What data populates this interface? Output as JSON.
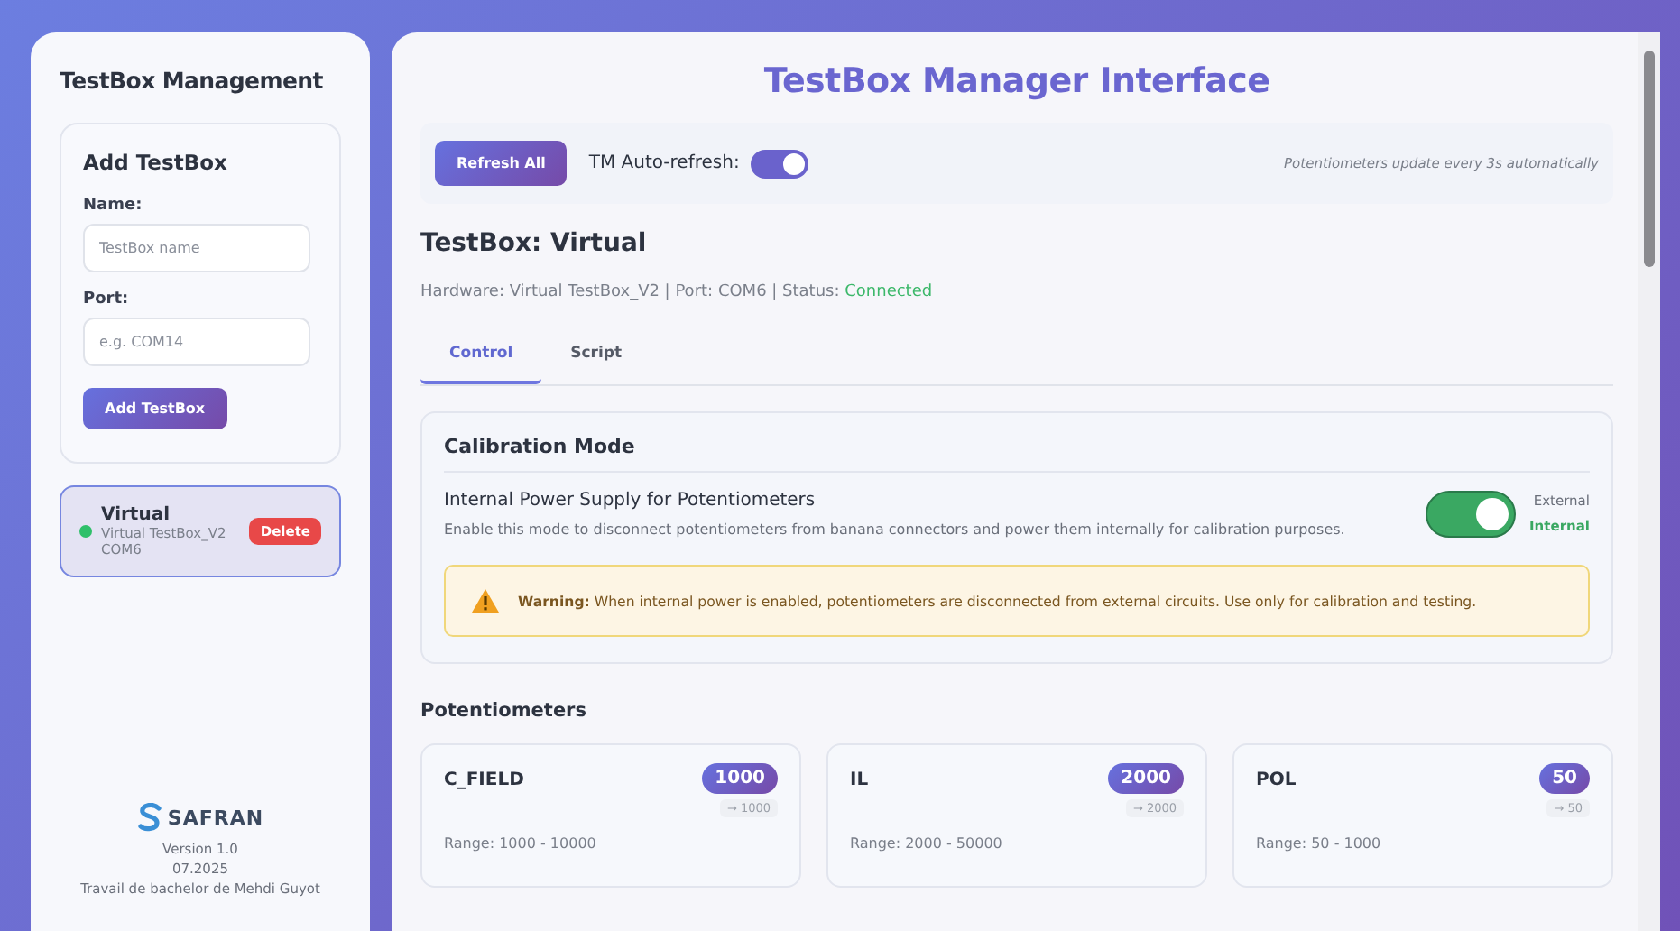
{
  "sidebar": {
    "title": "TestBox Management",
    "add_form": {
      "title": "Add TestBox",
      "fields": [
        {
          "label": "Name:",
          "placeholder": "TestBox name"
        },
        {
          "label": "Port:",
          "placeholder": "e.g. COM14"
        }
      ],
      "button": "Add TestBox"
    },
    "testboxes": [
      {
        "name": "Virtual",
        "hardware": "Virtual TestBox_V2",
        "port": "COM6",
        "connected": true,
        "selected": true,
        "delete": "Delete"
      }
    ],
    "footer": {
      "logo": "SAFRAN",
      "version": "Version 1.0",
      "date": "07.2025",
      "credit": "Travail de bachelor de Mehdi Guyot"
    }
  },
  "main": {
    "title": "TestBox Manager Interface",
    "toolbar": {
      "refresh": "Refresh All",
      "auto_refresh_label": "TM Auto-refresh:",
      "auto_refresh_on": true,
      "note": "Potentiometers update every 3s automatically"
    },
    "heading": "TestBox: Virtual",
    "info": "Hardware: Virtual TestBox_V2 | Port: COM6 | Status: ",
    "status": "Connected",
    "tabs": [
      {
        "label": "Control",
        "selected": true
      },
      {
        "label": "Script",
        "selected": false
      }
    ],
    "calibration": {
      "title": "Calibration Mode",
      "option_title": "Internal Power Supply for Potentiometers",
      "description": "Enable this mode to disconnect potentiometers from banana connectors and power them internally for calibration purposes.",
      "internal_on": true,
      "modes": [
        {
          "label": "External",
          "selected": false
        },
        {
          "label": "Internal",
          "selected": true
        }
      ],
      "warning": "**Warning:** When internal power is enabled, potentiometers are disconnected from external circuits. Use only for calibration and testing."
    },
    "potentiometers_title": "Potentiometers",
    "potentiometers": [
      {
        "name": "C_FIELD",
        "value": "1000",
        "target": "→ 1000",
        "range": "Range: 1000 - 10000"
      },
      {
        "name": "IL",
        "value": "2000",
        "target": "→ 2000",
        "range": "Range: 2000 - 50000"
      },
      {
        "name": "POL",
        "value": "50",
        "target": "→ 50",
        "range": "Range: 50 - 1000"
      }
    ]
  }
}
